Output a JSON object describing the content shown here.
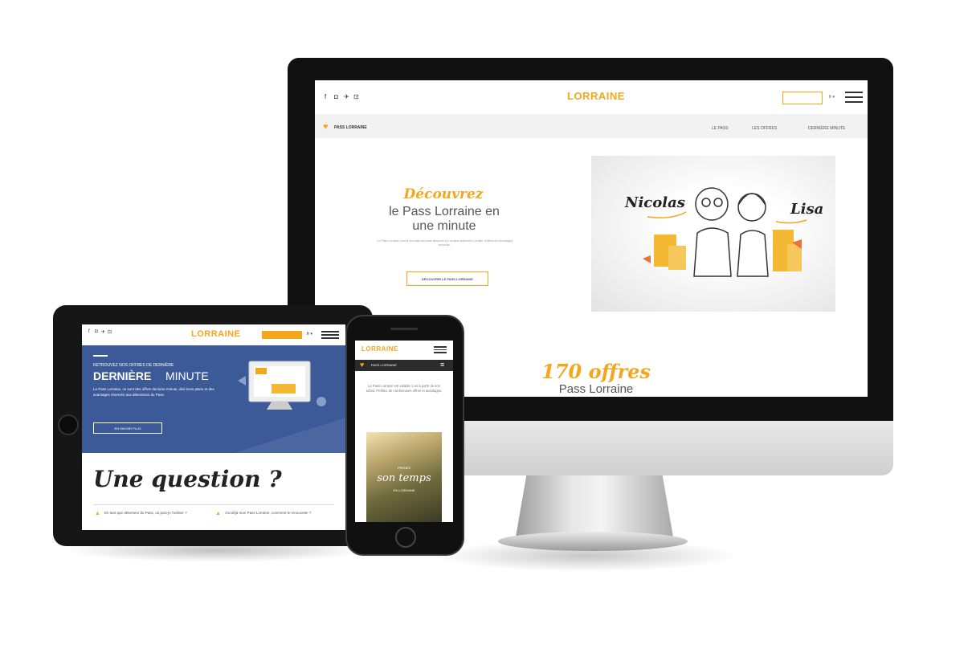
{
  "desktop": {
    "social_icons": [
      "f",
      "◘",
      "✈",
      "⊡"
    ],
    "logo": "LORRAINE",
    "logo_tagline": "",
    "header_button": "",
    "lang": "fr ▾",
    "nav": {
      "brand": "PASS LORRAINE",
      "items": [
        "LE PASS",
        "LES OFFRES",
        "DERNIÈRE MINUTE"
      ]
    },
    "hero": {
      "script_title": "Découvrez",
      "subtitle_line1": "le Pass Lorraine en",
      "subtitle_line2": "une minute",
      "body": "Le Pass Lorraine c'est le bon plan sûr pour découvrir la Lorraine autrement, profiter d'offres et d'avantages exclusifs...",
      "cta": "DÉCOUVRIR LE PASS LORRAINE"
    },
    "illustration": {
      "name1": "Nicolas",
      "name2": "Lisa"
    },
    "offers": {
      "count": "170 offres",
      "label": "Pass Lorraine"
    }
  },
  "tablet": {
    "social_icons": [
      "f",
      "◘",
      "✈",
      "⊡"
    ],
    "logo": "LORRAINE",
    "header_button": "",
    "lang": "fr ▾",
    "banner": {
      "kicker": "RETROUVEZ NOS OFFRES DE DERNIÈRE",
      "title_bold": "DERNIÈRE",
      "title_light": "MINUTE",
      "body": "Le Pass Lorraine, ce sont des offres dernière minute, des bons plans et des avantages réservés aux détenteurs du Pass.",
      "button": "EN SAVOIR PLUS"
    },
    "question_title": "Une question ?",
    "faq": [
      "En tant que détenteur du Pass, où puis-je l'utiliser ?",
      "J'ai déjà mon Pass Lorraine, comment le renouveler ?"
    ]
  },
  "phone": {
    "logo": "LORRAINE",
    "nav_brand": "PASS LORRAINE",
    "body": "Le Pass Lorraine est valable 1 an à partir de son achat. Profitez de nombreuses offres et avantages.",
    "photo_kicker": "PRENEZ",
    "photo_title": "son temps",
    "photo_caption": "EN LORRAINE"
  },
  "colors": {
    "accent": "#f4a61d",
    "banner_blue": "#3c5a98"
  }
}
